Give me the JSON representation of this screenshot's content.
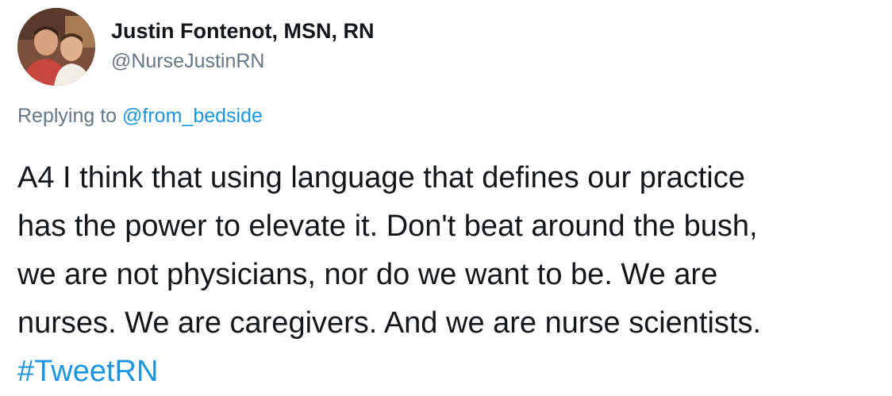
{
  "author": {
    "name": "Justin Fontenot, MSN, RN",
    "handle": "@NurseJustinRN"
  },
  "reply": {
    "prefix": "Replying to",
    "mention": "@from_bedside"
  },
  "tweet": {
    "lines": [
      "A4 I think that using language that defines our practice",
      "has the power to elevate it. Don't beat around the bush,",
      "we are not physicians, nor do we want to be. We are",
      "nurses. We are caregivers. And we are nurse scientists."
    ],
    "hashtag": "#TweetRN"
  },
  "colors": {
    "text": "#14171a",
    "secondary": "#657786",
    "link": "#1b95e0"
  }
}
